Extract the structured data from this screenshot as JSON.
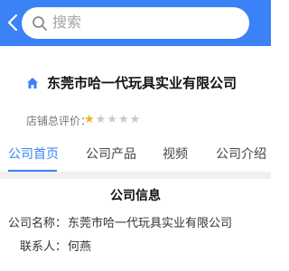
{
  "header": {
    "search_placeholder": "搜索",
    "colors": {
      "bar": "#3b82f6"
    }
  },
  "company": {
    "name": "东莞市哈一代玩具实业有限公司",
    "rating_label": "店铺总评价：",
    "rating_stars": 1,
    "rating_max": 5
  },
  "tabs": [
    {
      "label": "公司首页",
      "active": true
    },
    {
      "label": "公司产品",
      "active": false
    },
    {
      "label": "视频",
      "active": false
    },
    {
      "label": "公司介绍",
      "active": false
    }
  ],
  "info": {
    "title": "公司信息",
    "rows": [
      {
        "label": "公司名称：",
        "value": "东莞市哈一代玩具实业有限公司"
      },
      {
        "label": "联系人：",
        "value": "何燕"
      }
    ]
  }
}
